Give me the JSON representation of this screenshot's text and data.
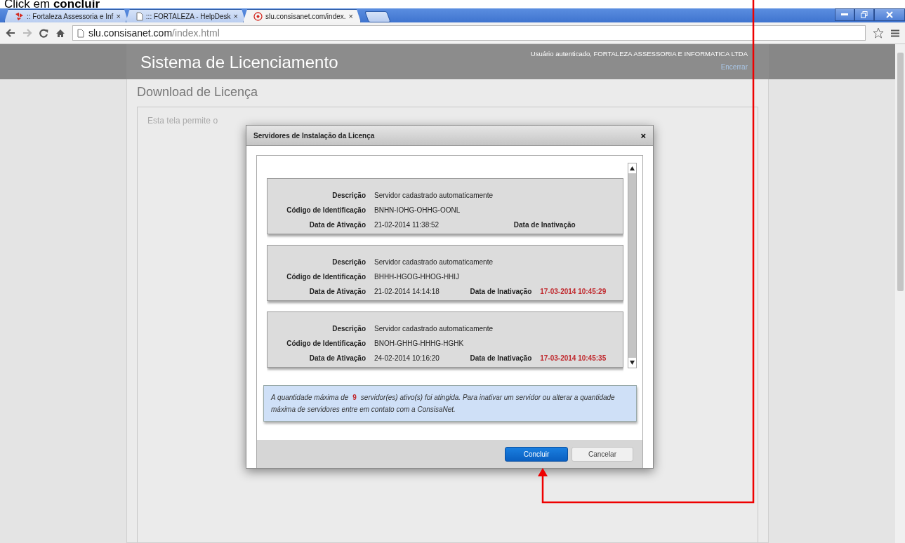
{
  "caption": "Click em **concluir**",
  "browser": {
    "tabs": [
      {
        "title": ":: Fortaleza Assessoria e Inf",
        "close": "×",
        "selected": false
      },
      {
        "title": "::: FORTALEZA - HelpDesk",
        "close": "×",
        "selected": false
      },
      {
        "title": "slu.consisanet.com/index.",
        "close": "×",
        "selected": true
      }
    ],
    "url_host": "slu.consisanet.com",
    "url_path": "/index.html"
  },
  "header": {
    "title": "Sistema de Licenciamento",
    "user": "Usuário autenticado, FORTALEZA ASSESSORIA E INFORMATICA LTDA",
    "logout": "Encerrar"
  },
  "page": {
    "title": "Download de Licença",
    "intro": "Esta tela permite o"
  },
  "dialog": {
    "title": "Servidores de Instalação da Licença",
    "close": "×",
    "servers": [
      {
        "labels": {
          "description": "Descrição",
          "code": "Código de Identificação",
          "activation": "Data de Ativação",
          "inactivation": "Data de Inativação"
        },
        "description": "Servidor cadastrado automaticamente",
        "code": "BNHN-IOHG-OHHG-OONL",
        "activation": "21-02-2014 11:38:52"
      },
      {
        "labels": {
          "description": "Descrição",
          "code": "Código de Identificação",
          "activation": "Data de Ativação",
          "inactivation": "Data de Inativação"
        },
        "description": "Servidor cadastrado automaticamente",
        "code": "BHHH-HGOG-HHOG-HHIJ",
        "activation": "21-02-2014 14:14:18",
        "inactivation": "17-03-2014 10:45:29"
      },
      {
        "labels": {
          "description": "Descrição",
          "code": "Código de Identificação",
          "activation": "Data de Ativação",
          "inactivation": "Data de Inativação"
        },
        "description": "Servidor cadastrado automaticamente",
        "code": "BNOH-GHHG-HHHG-HGHK",
        "activation": "24-02-2014 10:16:20",
        "inactivation": "17-03-2014 10:45:35"
      }
    ],
    "notice": {
      "before": "A quantidade máxima de",
      "count": "9",
      "after": "servidor(es) ativo(s) foi atingida. Para inativar um servidor ou alterar a quantidade máxima de servidores entre em contato com a ConsisaNet."
    },
    "buttons": [
      {
        "label": "Concluir",
        "kind": "primary"
      },
      {
        "label": "Cancelar",
        "kind": "secondary"
      }
    ]
  }
}
